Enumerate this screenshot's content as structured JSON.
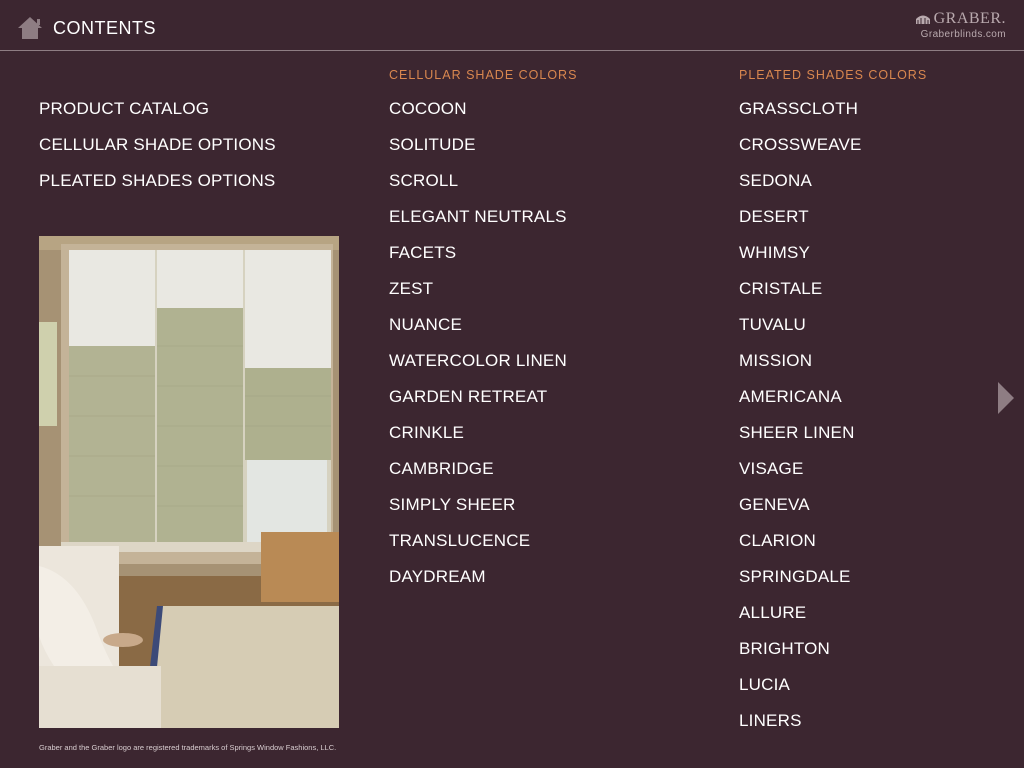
{
  "header": {
    "title": "CONTENTS",
    "logo_name": "GRABER.",
    "logo_url": "Graberblinds.com"
  },
  "nav": {
    "items": [
      {
        "label": "PRODUCT CATALOG"
      },
      {
        "label": "CELLULAR SHADE OPTIONS"
      },
      {
        "label": "PLEATED SHADES OPTIONS"
      }
    ]
  },
  "cellular": {
    "heading": "CELLULAR SHADE COLORS",
    "items": [
      "COCOON",
      "SOLITUDE",
      "SCROLL",
      "ELEGANT NEUTRALS",
      "FACETS",
      "ZEST",
      "NUANCE",
      "WATERCOLOR LINEN",
      "GARDEN RETREAT",
      "CRINKLE",
      "CAMBRIDGE",
      "SIMPLY SHEER",
      "TRANSLUCENCE",
      "DAYDREAM"
    ]
  },
  "pleated": {
    "heading": "PLEATED SHADES COLORS",
    "items": [
      "GRASSCLOTH",
      "CROSSWEAVE",
      "SEDONA",
      "DESERT",
      "WHIMSY",
      "CRISTALE",
      "TUVALU",
      "MISSION",
      "AMERICANA",
      "SHEER LINEN",
      "VISAGE",
      "GENEVA",
      "CLARION",
      "SPRINGDALE",
      "ALLURE",
      "BRIGHTON",
      "LUCIA",
      "LINERS"
    ]
  },
  "footer": {
    "trademark": "Graber and the Graber logo are registered trademarks of Springs Window Fashions, LLC."
  },
  "colors": {
    "background": "#3c2630",
    "heading_accent": "#d9874f",
    "text": "#ffffff",
    "muted": "#b9a9ae"
  },
  "icons": {
    "home": "home-icon",
    "next": "chevron-right-icon",
    "logo": "graber-logo"
  }
}
